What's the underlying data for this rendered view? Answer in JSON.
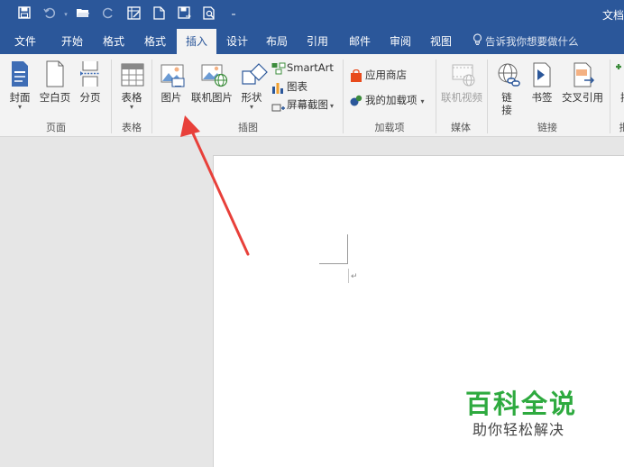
{
  "window": {
    "doc_title": "文档"
  },
  "quick_access": {
    "save_icon": "save-icon",
    "undo_icon": "undo-icon",
    "open_icon": "open-folder-icon",
    "redo_icon": "redo-icon",
    "grid_icon": "table-insert-icon",
    "new_icon": "new-document-icon",
    "saveas_icon": "save-as-icon",
    "preview_icon": "print-preview-icon",
    "customize_icon": "customize-toolbar-icon"
  },
  "tabs": [
    {
      "label": "文件"
    },
    {
      "label": "开始"
    },
    {
      "label": "格式"
    },
    {
      "label": "格式"
    },
    {
      "label": "插入"
    },
    {
      "label": "设计"
    },
    {
      "label": "布局"
    },
    {
      "label": "引用"
    },
    {
      "label": "邮件"
    },
    {
      "label": "审阅"
    },
    {
      "label": "视图"
    }
  ],
  "tell_me": "告诉我你想要做什么",
  "ribbon": {
    "pages": {
      "cover": "封面",
      "blank": "空白页",
      "break": "分页",
      "group": "页面"
    },
    "tables": {
      "table": "表格",
      "group": "表格"
    },
    "illustrations": {
      "pictures": "图片",
      "online_pictures": "联机图片",
      "shapes": "形状",
      "smartart": "SmartArt",
      "chart": "图表",
      "screenshot": "屏幕截图",
      "group": "插图"
    },
    "addins": {
      "store": "应用商店",
      "my_addins": "我的加载项",
      "group": "加载项"
    },
    "media": {
      "online_video": "联机视频",
      "group": "媒体"
    },
    "links": {
      "link_line1": "链",
      "link_line2": "接",
      "bookmark": "书签",
      "cross_ref": "交叉引用",
      "group": "链接"
    },
    "dropdown_glyph": "▾",
    "more_glyph": "插",
    "more_group": "批"
  },
  "document": {
    "paragraph_mark": "↵"
  },
  "watermark": {
    "title": "百科全说",
    "subtitle": "助你轻松解决"
  },
  "colors": {
    "title_bar": "#2b579a",
    "ribbon_bg": "#f3f3f3",
    "active_tab_text": "#2b579a",
    "arrow": "#e8403a",
    "watermark_green": "#2eaa3f"
  }
}
